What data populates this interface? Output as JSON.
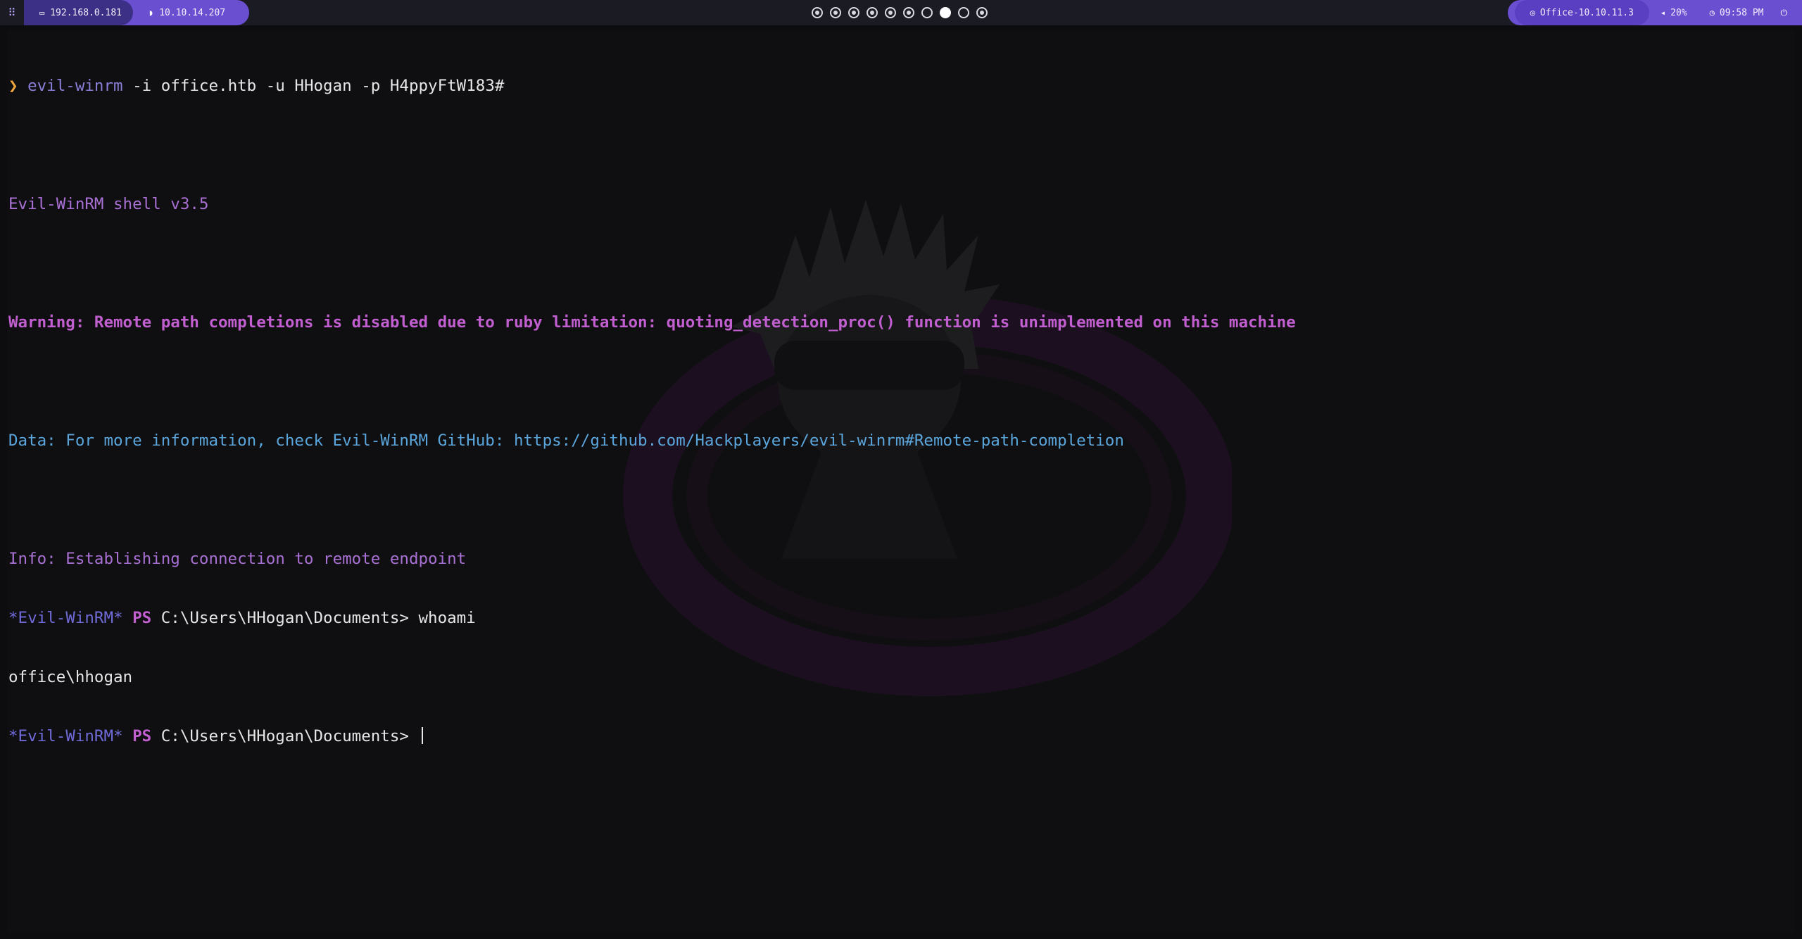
{
  "topbar": {
    "left": {
      "local_ip": "192.168.0.181",
      "vpn_ip": "10.10.14.207"
    },
    "workspaces": [
      "filled",
      "filled",
      "filled",
      "filled",
      "filled",
      "filled",
      "empty",
      "active",
      "empty",
      "filled"
    ],
    "right": {
      "target": "Office-10.10.11.3",
      "volume": "20%",
      "clock": "09:58 PM"
    }
  },
  "terminal": {
    "prompt_symbol": "❯",
    "command_name": "evil-winrm",
    "command_args": " -i office.htb -u HHogan -p H4ppyFtW183#",
    "banner": "Evil-WinRM shell v3.5",
    "warning": "Warning: Remote path completions is disabled due to ruby limitation: quoting_detection_proc() function is unimplemented on this machine",
    "data_line": "Data: For more information, check Evil-WinRM GitHub: https://github.com/Hackplayers/evil-winrm#Remote-path-completion",
    "info_line": "Info: Establishing connection to remote endpoint",
    "ps_prefix": "*Evil-WinRM*",
    "ps_label": "PS",
    "ps_path": " C:\\Users\\HHogan\\Documents> ",
    "cmd1": "whoami",
    "output1": "office\\hhogan"
  },
  "colors": {
    "accent": "#6b4fd1",
    "bar_bg": "#1b1b24",
    "terminal_bg": "#0f0f11"
  }
}
